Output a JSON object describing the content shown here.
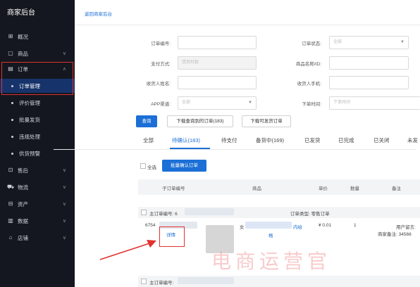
{
  "brand": {
    "title": "商家后台"
  },
  "sidebar": {
    "items": [
      {
        "label": "概况",
        "icon": "grid-icon"
      },
      {
        "label": "商品",
        "icon": "bag-icon"
      },
      {
        "label": "订单",
        "icon": "order-icon"
      }
    ],
    "order_sub": [
      {
        "label": "订单管理"
      },
      {
        "label": "评价管理"
      },
      {
        "label": "批量发货"
      },
      {
        "label": "违规处理"
      },
      {
        "label": "供货预警"
      }
    ],
    "items_bottom": [
      {
        "label": "售后"
      },
      {
        "label": "物流"
      },
      {
        "label": "资产"
      },
      {
        "label": "数据"
      },
      {
        "label": "店铺"
      }
    ]
  },
  "header": {
    "back_link": "返回商家后台"
  },
  "filters": {
    "order_no_label": "订单编号:",
    "order_status_label": "订单状态:",
    "order_status_value": "全部",
    "pay_method_label": "支付方式:",
    "pay_method_value": "货到付款",
    "product_label": "商品名称/ID:",
    "receiver_name_label": "收货人姓名:",
    "receiver_phone_label": "收货人手机:",
    "app_channel_label": "APP渠道:",
    "app_channel_value": "全部",
    "order_time_label": "下单时间:",
    "order_time_placeholder": "下单时间"
  },
  "actions": {
    "query": "查询",
    "download_query": "下载查询到的订单(183)",
    "download_shippable": "下载可发货订单"
  },
  "tabs": [
    {
      "label": "全部"
    },
    {
      "label": "待确认(183)"
    },
    {
      "label": "待支付"
    },
    {
      "label": "备货中(169)"
    },
    {
      "label": "已发货"
    },
    {
      "label": "已完成"
    },
    {
      "label": "已关闭"
    },
    {
      "label": "未发"
    }
  ],
  "bulk": {
    "select_all": "全选",
    "confirm_button": "批量确认订单"
  },
  "table": {
    "headers": [
      "子订单编号",
      "商品",
      "单价",
      "数量",
      "备注"
    ]
  },
  "order": {
    "main_no_label": "主订单编号: 6",
    "order_type": "订单类型: 零售订单",
    "sub_no": "6754",
    "product_prefix": "女",
    "product_suffix": "内给",
    "spec": "格",
    "price": "¥ 0.01",
    "qty": "1",
    "user_note": "用户留言:",
    "merchant_note": "商家备注: 34566",
    "detail_link": "详情"
  },
  "order2": {
    "main_no_label": "主订单编号:"
  },
  "watermark": {
    "text": "电商运营官"
  },
  "colors": {
    "accent": "#1b6fd6",
    "sidebar_bg": "#14171f",
    "highlight": "#e0322f",
    "active_bg": "#17336b"
  }
}
